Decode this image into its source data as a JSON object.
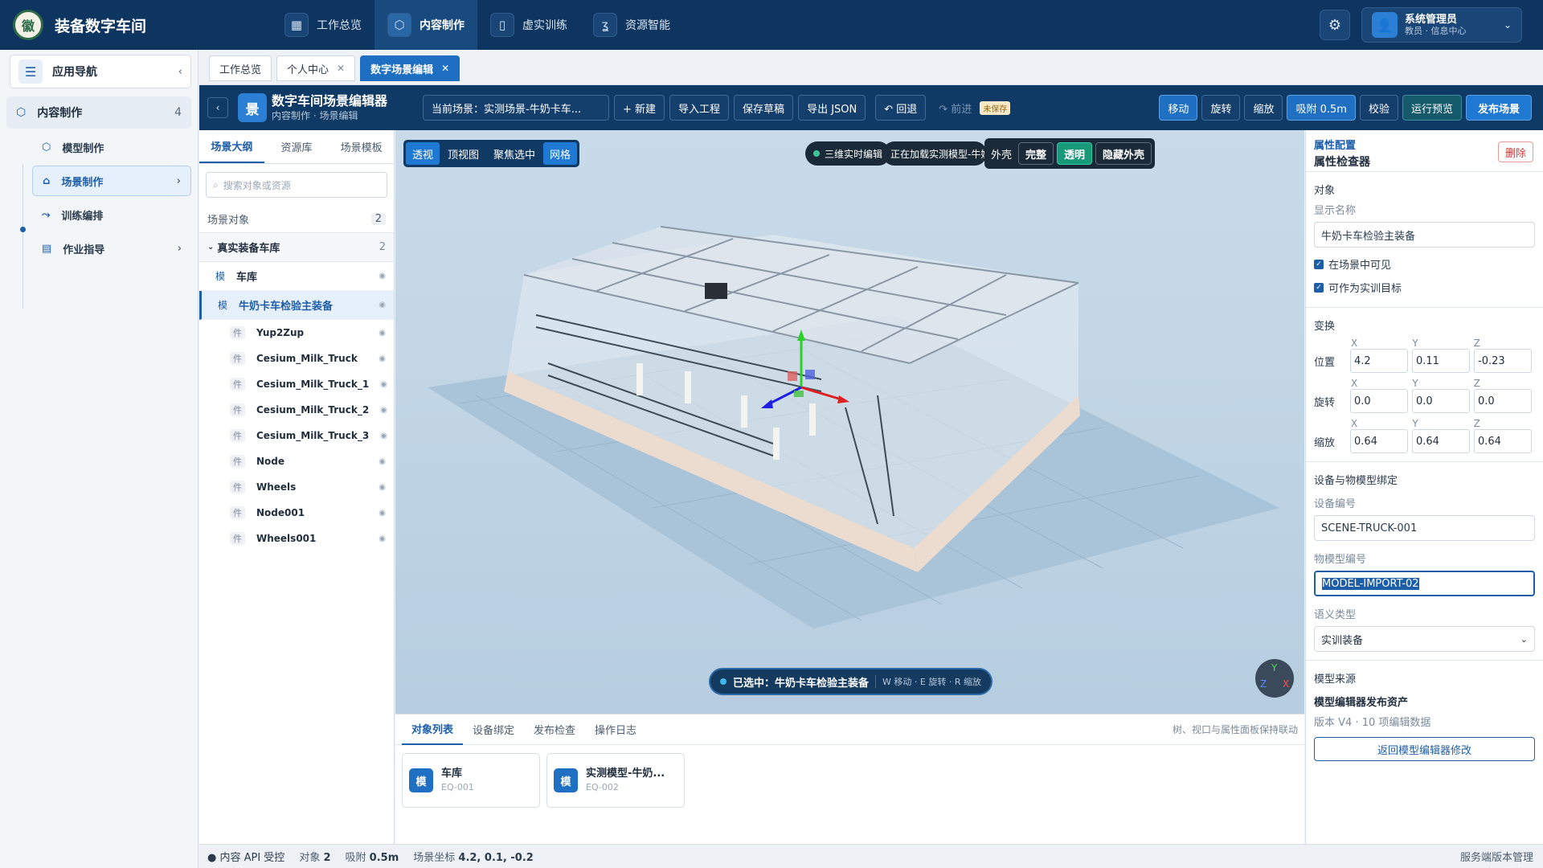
{
  "app": {
    "title": "装备数字车间",
    "logo_text": "徽"
  },
  "nav": [
    {
      "label": "工作总览",
      "icon": "grid-icon"
    },
    {
      "label": "内容制作",
      "icon": "cube-icon",
      "active": true
    },
    {
      "label": "虚实训练",
      "icon": "book-icon"
    },
    {
      "label": "资源智能",
      "icon": "brain-icon"
    }
  ],
  "user": {
    "name": "系统管理员",
    "role": "教员 · 信息中心"
  },
  "sidebar": {
    "title": "应用导航",
    "group": {
      "label": "内容制作",
      "count": "4"
    },
    "items": [
      {
        "label": "模型制作",
        "icon": "cube-icon"
      },
      {
        "label": "场景制作",
        "icon": "home-icon",
        "active": true
      },
      {
        "label": "训练编排",
        "icon": "flow-icon"
      },
      {
        "label": "作业指导",
        "icon": "doc-icon"
      }
    ]
  },
  "page_tabs": [
    {
      "label": "工作总览"
    },
    {
      "label": "个人中心"
    },
    {
      "label": "数字场景编辑",
      "active": true
    }
  ],
  "editor": {
    "icon_text": "景",
    "title": "数字车间场景编辑器",
    "subtitle": "内容制作 · 场景编辑",
    "current_scene": "当前场景：实测场景-牛奶卡车...",
    "buttons": {
      "new": "+ 新建",
      "import": "导入工程",
      "save": "保存草稿",
      "export": "导出 JSON",
      "undo": "↶ 回退",
      "redo": "↷ 前进",
      "unsaved": "未保存"
    },
    "tools": {
      "move": "移动",
      "rotate": "旋转",
      "scale": "缩放",
      "snap": "吸附 0.5m",
      "check": "校验",
      "preview": "运行预览",
      "publish": "发布场景"
    }
  },
  "outline": {
    "tabs": [
      "场景大纲",
      "资源库",
      "场景模板"
    ],
    "search_placeholder": "搜索对象或资源",
    "section": {
      "label": "场景对象",
      "count": "2"
    },
    "group": {
      "label": "真实装备车库",
      "count": "2"
    },
    "rows": [
      {
        "tag": "模",
        "label": "车库"
      },
      {
        "tag": "模",
        "label": "牛奶卡车检验主装备",
        "selected": true
      }
    ],
    "children": [
      "Yup2Zup",
      "Cesium_Milk_Truck",
      "Cesium_Milk_Truck_1",
      "Cesium_Milk_Truck_2",
      "Cesium_Milk_Truck_3",
      "Node",
      "Wheels",
      "Node001",
      "Wheels001"
    ],
    "child_tag": "件"
  },
  "viewport": {
    "views": [
      "透视",
      "顶视图",
      "聚焦选中",
      "网格"
    ],
    "status_live": "三维实时编辑",
    "status_loading": "正在加载实测模型-牛奶",
    "shell": {
      "label": "外壳",
      "full": "完整",
      "transparent": "透明",
      "hide": "隐藏外壳"
    },
    "selected": "已选中：牛奶卡车检验主装备",
    "hint": "W 移动 · E 旋转 · R 缩放",
    "axes": {
      "y": "Y",
      "z": "Z",
      "x": "X"
    }
  },
  "bottom": {
    "tabs": [
      "对象列表",
      "设备绑定",
      "发布检查",
      "操作日志"
    ],
    "note": "树、视口与属性面板保持联动",
    "cards": [
      {
        "badge": "模",
        "name": "车库",
        "code": "EQ-001"
      },
      {
        "badge": "模",
        "name": "实测模型-牛奶...",
        "code": "EQ-002"
      }
    ]
  },
  "props": {
    "kicker": "属性配置",
    "title": "属性检查器",
    "delete": "删除",
    "object_section": "对象",
    "display_name_label": "显示名称",
    "display_name": "牛奶卡车检验主装备",
    "visible": "在场景中可见",
    "target": "可作为实训目标",
    "transform_section": "变换",
    "axes": [
      "X",
      "Y",
      "Z"
    ],
    "position": {
      "label": "位置",
      "x": "4.2",
      "y": "0.11",
      "z": "-0.23"
    },
    "rotation": {
      "label": "旋转",
      "x": "0.0",
      "y": "0.0",
      "z": "0.0"
    },
    "scale": {
      "label": "缩放",
      "x": "0.64",
      "y": "0.64",
      "z": "0.64"
    },
    "binding_section": "设备与物模型绑定",
    "device_code_label": "设备编号",
    "device_code": "SCENE-TRUCK-001",
    "model_code_label": "物模型编号",
    "model_code": "MODEL-IMPORT-02",
    "semantic_label": "语义类型",
    "semantic_value": "实训装备",
    "source_section": "模型来源",
    "source_name": "模型编辑器发布资产",
    "source_version": "版本 V4 · 10 项编辑数据",
    "back_button": "返回模型编辑器修改"
  },
  "statusbar": {
    "api": "● 内容 API 受控",
    "objects_label": "对象",
    "objects": "2",
    "snap_label": "吸附",
    "snap": "0.5m",
    "coord_label": "场景坐标",
    "coord": "4.2, 0.1, -0.2",
    "right": "服务端版本管理"
  }
}
